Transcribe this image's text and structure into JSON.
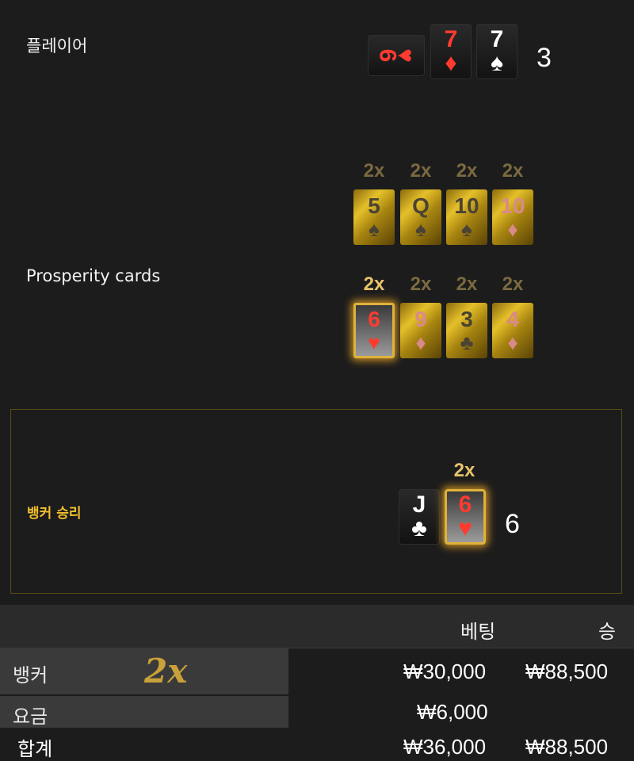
{
  "player": {
    "label": "플레이어",
    "total": "3",
    "cards": [
      {
        "rank": "6",
        "suit": "♥",
        "color": "red",
        "rotated": true
      },
      {
        "rank": "7",
        "suit": "♦",
        "color": "red"
      },
      {
        "rank": "7",
        "suit": "♠",
        "color": "white"
      }
    ]
  },
  "prosperity": {
    "label": "Prosperity cards",
    "row1": [
      {
        "mult": "2x",
        "rank": "5",
        "suit": "♠"
      },
      {
        "mult": "2x",
        "rank": "Q",
        "suit": "♠"
      },
      {
        "mult": "2x",
        "rank": "10",
        "suit": "♠"
      },
      {
        "mult": "2x",
        "rank": "10",
        "suit": "♦"
      }
    ],
    "row2": [
      {
        "mult": "2x",
        "rank": "6",
        "suit": "♥",
        "highlighted": true
      },
      {
        "mult": "2x",
        "rank": "9",
        "suit": "♦"
      },
      {
        "mult": "2x",
        "rank": "3",
        "suit": "♣"
      },
      {
        "mult": "2x",
        "rank": "4",
        "suit": "♦"
      }
    ]
  },
  "banker": {
    "result_label": "뱅커 승리",
    "total": "6",
    "mult": "2x",
    "cards": [
      {
        "rank": "J",
        "suit": "♣",
        "color": "white"
      },
      {
        "rank": "6",
        "suit": "♥",
        "color": "red",
        "highlighted": true
      }
    ]
  },
  "table": {
    "headers": {
      "bet": "베팅",
      "win": "승"
    },
    "rows": [
      {
        "label": "뱅커",
        "mult": "2x",
        "bet": "₩30,000",
        "win": "₩88,500"
      },
      {
        "label": "요금",
        "bet": "₩6,000",
        "win": ""
      },
      {
        "label": "합계",
        "bet": "₩36,000",
        "win": "₩88,500"
      }
    ]
  }
}
